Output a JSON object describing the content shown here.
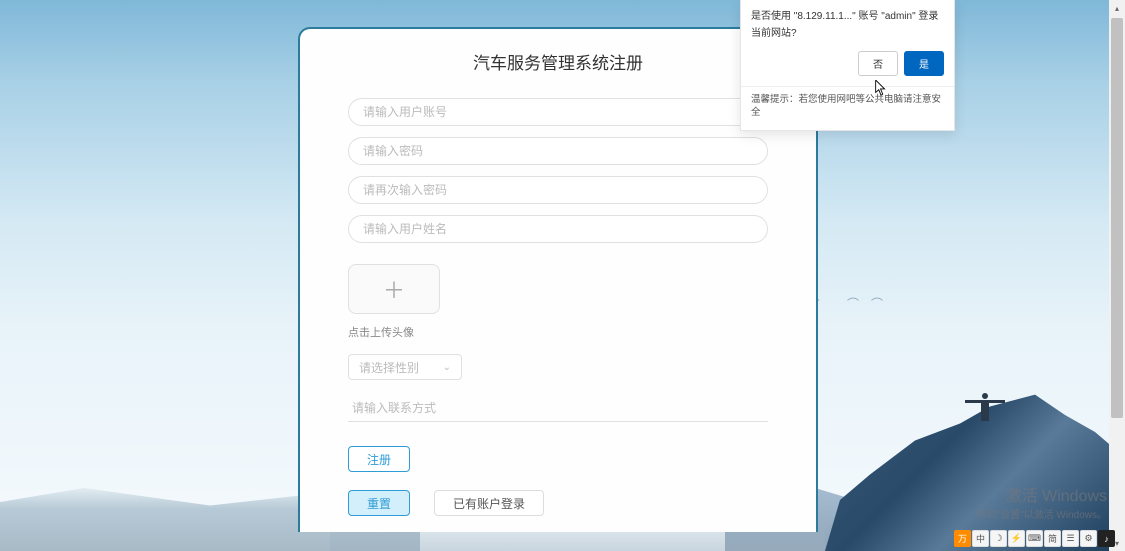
{
  "form": {
    "title": "汽车服务管理系统注册",
    "username_placeholder": "请输入用户账号",
    "password_placeholder": "请输入密码",
    "password_confirm_placeholder": "请再次输入密码",
    "nickname_placeholder": "请输入用户姓名",
    "upload_hint": "点击上传头像",
    "gender_placeholder": "请选择性别",
    "contact_placeholder": "请输入联系方式",
    "register_label": "注册",
    "reset_label": "重置",
    "has_account_label": "已有账户登录"
  },
  "autofill_prompt": {
    "line1": "是否使用 \"8.129.11.1...\" 账号 \"admin\" 登录",
    "line2": "当前网站?",
    "no_label": "否",
    "yes_label": "是",
    "tip": "温馨提示：若您使用网吧等公共电脑请注意安全"
  },
  "watermark": {
    "line1": "激活 Windows",
    "line2": "转到\"设置\"以激活 Windows。"
  },
  "tray": {
    "items": [
      "万",
      "中",
      "☽",
      "⚡",
      "⌨",
      "简",
      "☰",
      "⚙",
      "♪"
    ]
  },
  "colors": {
    "card_border": "#2c7a9c",
    "primary_blue": "#2e9cd6",
    "prompt_yes_bg": "#0067c0"
  }
}
